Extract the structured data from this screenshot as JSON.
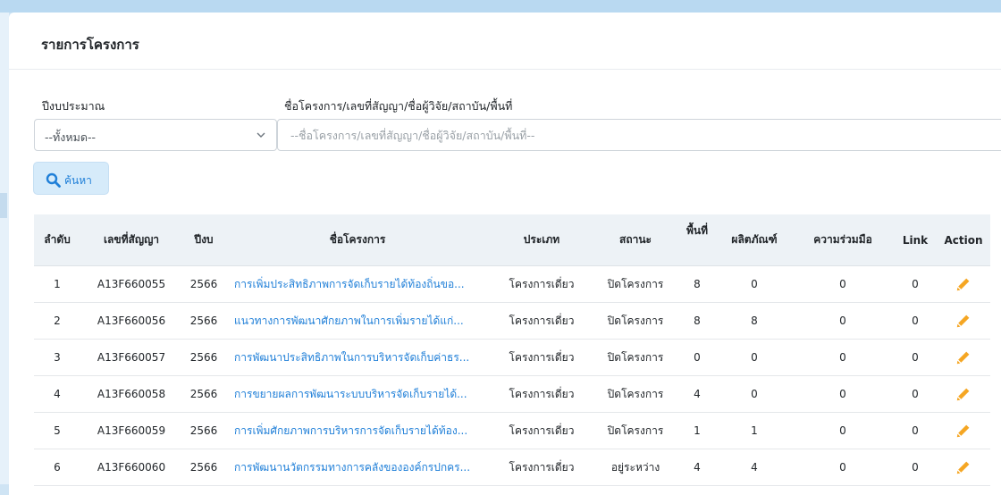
{
  "card": {
    "title": "รายการโครงการ"
  },
  "filters": {
    "year_label": "ปีงบประมาณ",
    "year_value": "--ทั้งหมด--",
    "query_label": "ชื่อโครงการ/เลขที่สัญญา/ชื่อผู้วิจัย/สถาบัน/พื้นที่",
    "query_placeholder": "--ชื่อโครงการ/เลขที่สัญญา/ชื่อผู้วิจัย/สถาบัน/พื้นที่--",
    "search_label": "ค้นหา"
  },
  "table": {
    "headers": [
      "ลำดับ",
      "เลขที่สัญญา",
      "ปีงบ",
      "ชื่อโครงการ",
      "ประเภท",
      "สถานะ",
      "พื้นที่",
      "ผลิตภัณฑ์",
      "ความร่วมมือ",
      "Link",
      "Action"
    ],
    "rows": [
      {
        "no": "1",
        "contract": "A13F660055",
        "year": "2566",
        "name": "การเพิ่มประสิทธิภาพการจัดเก็บรายได้ท้องถิ่นขอ...",
        "type": "โครงการเดี่ยว",
        "status": "ปิดโครงการ",
        "area": "8",
        "product": "0",
        "collab": "0",
        "link": "0"
      },
      {
        "no": "2",
        "contract": "A13F660056",
        "year": "2566",
        "name": "แนวทางการพัฒนาศักยภาพในการเพิ่มรายได้แก่...",
        "type": "โครงการเดี่ยว",
        "status": "ปิดโครงการ",
        "area": "8",
        "product": "8",
        "collab": "0",
        "link": "0"
      },
      {
        "no": "3",
        "contract": "A13F660057",
        "year": "2566",
        "name": "การพัฒนาประสิทธิภาพในการบริหารจัดเก็บค่าธร...",
        "type": "โครงการเดี่ยว",
        "status": "ปิดโครงการ",
        "area": "0",
        "product": "0",
        "collab": "0",
        "link": "0"
      },
      {
        "no": "4",
        "contract": "A13F660058",
        "year": "2566",
        "name": "การขยายผลการพัฒนาระบบบริหารจัดเก็บรายได้...",
        "type": "โครงการเดี่ยว",
        "status": "ปิดโครงการ",
        "area": "4",
        "product": "0",
        "collab": "0",
        "link": "0"
      },
      {
        "no": "5",
        "contract": "A13F660059",
        "year": "2566",
        "name": "การเพิ่มศักยภาพการบริหารการจัดเก็บรายได้ท้อง...",
        "type": "โครงการเดี่ยว",
        "status": "ปิดโครงการ",
        "area": "1",
        "product": "1",
        "collab": "0",
        "link": "0"
      },
      {
        "no": "6",
        "contract": "A13F660060",
        "year": "2566",
        "name": "การพัฒนานวัตกรรมทางการคลังขององค์กรปกคร...",
        "type": "โครงการเดี่ยว",
        "status": "อยู่ระหว่าง",
        "area": "4",
        "product": "4",
        "collab": "0",
        "link": "0"
      }
    ]
  },
  "colors": {
    "link": "#1f7fd8",
    "pencil": "#f5a623",
    "header_bg": "#edf2f6",
    "button_bg": "#d6ebfa"
  },
  "icons": {
    "search": "search-icon",
    "dropdown": "chevron-down-icon",
    "edit": "pencil-icon"
  }
}
